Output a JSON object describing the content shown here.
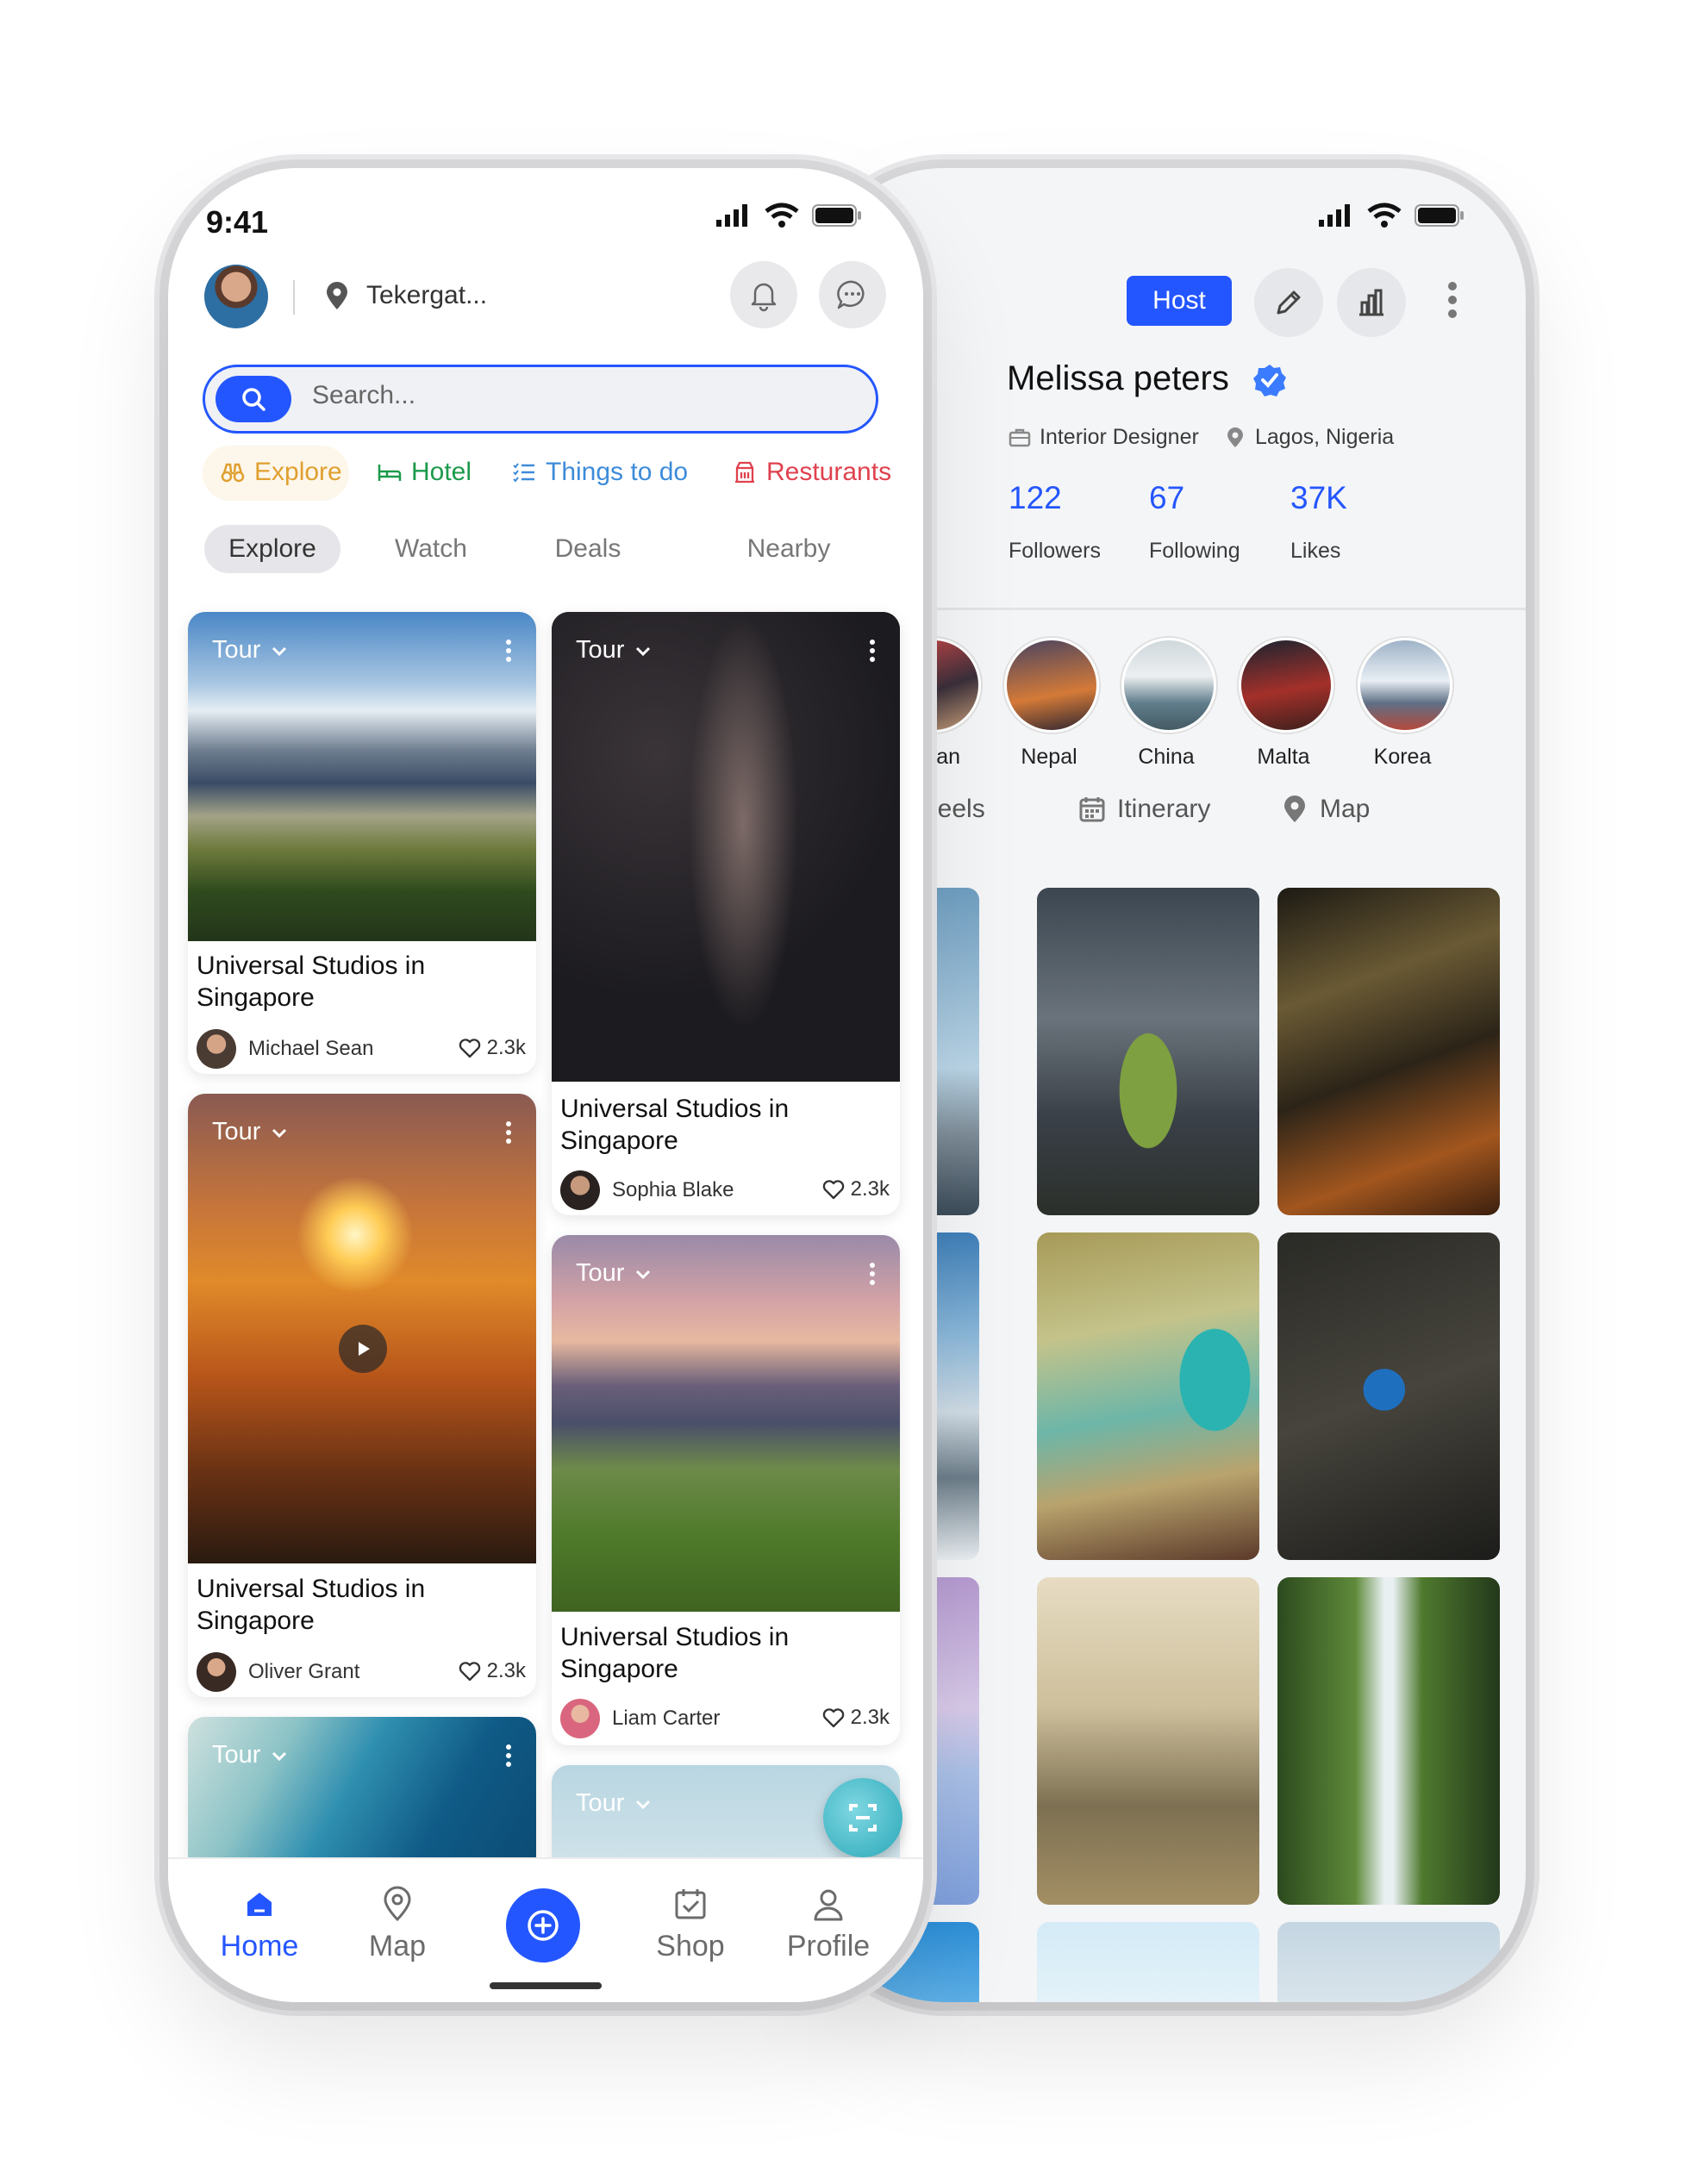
{
  "status": {
    "time": "9:41"
  },
  "header": {
    "location": "Tekergat..."
  },
  "search": {
    "placeholder": "Search..."
  },
  "categories": [
    {
      "label": "Explore",
      "color": "#e0a030"
    },
    {
      "label": "Hotel",
      "color": "#1c9a4b"
    },
    {
      "label": "Things to do",
      "color": "#3d8bd9"
    },
    {
      "label": "Resturants",
      "color": "#e0414e"
    }
  ],
  "segments": [
    "Explore",
    "Watch",
    "Deals",
    "Nearby"
  ],
  "cards": [
    {
      "tag": "Tour",
      "title": "Universal Studios in Singapore",
      "author": "Michael Sean",
      "likes": "2.3k"
    },
    {
      "tag": "Tour",
      "title": "Universal Studios in Singapore",
      "author": "Sophia Blake",
      "likes": "2.3k"
    },
    {
      "tag": "Tour",
      "title": "Universal Studios in Singapore",
      "author": "Oliver Grant",
      "likes": "2.3k"
    },
    {
      "tag": "Tour",
      "title": "Universal Studios in Singapore",
      "author": "Liam Carter",
      "likes": "2.3k"
    },
    {
      "tag": "Tour"
    },
    {
      "tag": "Tour"
    }
  ],
  "bottom_nav": [
    "Home",
    "Map",
    "Shop",
    "Profile"
  ],
  "profile": {
    "host_label": "Host",
    "name": "Melissa peters",
    "job": "Interior Designer",
    "location": "Lagos, Nigeria",
    "stats": [
      {
        "value": "122",
        "label": "Followers"
      },
      {
        "value": "67",
        "label": "Following"
      },
      {
        "value": "37K",
        "label": "Likes"
      }
    ],
    "destinations": [
      "n",
      "Japan",
      "Nepal",
      "China",
      "Malta",
      "Korea"
    ],
    "tabs": [
      "Reels",
      "Itinerary",
      "Map"
    ]
  },
  "colors": {
    "accent": "#2456ff"
  }
}
